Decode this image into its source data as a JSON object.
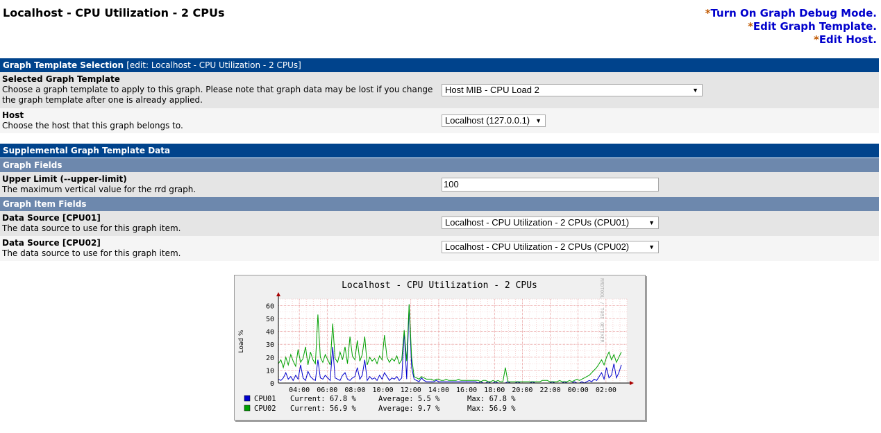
{
  "page": {
    "title": "Localhost - CPU Utilization - 2 CPUs"
  },
  "top_links": [
    {
      "star": "*",
      "label": "Turn On Graph Debug Mode."
    },
    {
      "star": "*",
      "label": "Edit Graph Template."
    },
    {
      "star": "*",
      "label": "Edit Host."
    }
  ],
  "template_section": {
    "header": "Graph Template Selection",
    "header_edit": "[edit: Localhost - CPU Utilization - 2 CPUs]",
    "selected_template": {
      "label": "Selected Graph Template",
      "desc": "Choose a graph template to apply to this graph. Please note that graph data may be lost if you change the graph template after one is already applied.",
      "value": "Host MIB - CPU Load 2"
    },
    "host": {
      "label": "Host",
      "desc": "Choose the host that this graph belongs to.",
      "value": "Localhost (127.0.0.1)"
    }
  },
  "supplemental": {
    "header": "Supplemental Graph Template Data",
    "graph_fields": "Graph Fields",
    "upper_limit": {
      "label": "Upper Limit (--upper-limit)",
      "desc": "The maximum vertical value for the rrd graph.",
      "value": "100"
    },
    "graph_item_fields": "Graph Item Fields",
    "ds1": {
      "label": "Data Source [CPU01]",
      "desc": "The data source to use for this graph item.",
      "value": "Localhost - CPU Utilization - 2 CPUs (CPU01)"
    },
    "ds2": {
      "label": "Data Source [CPU02]",
      "desc": "The data source to use for this graph item.",
      "value": "Localhost - CPU Utilization - 2 CPUs (CPU02)"
    }
  },
  "icons": {
    "dropdown": "triangle-down"
  },
  "chart_data": {
    "type": "line",
    "title": "Localhost - CPU Utilization - 2 CPUs",
    "ylabel": "Load %",
    "watermark": "RRDTOOL / TOBI OETIKER",
    "ylim": [
      0,
      65
    ],
    "yticks": [
      0,
      10,
      20,
      30,
      40,
      50,
      60
    ],
    "x_tick_labels": [
      "04:00",
      "06:00",
      "08:00",
      "10:00",
      "12:00",
      "14:00",
      "16:00",
      "18:00",
      "20:00",
      "22:00",
      "00:00",
      "02:00"
    ],
    "x_hours": [
      2.5,
      27.5
    ],
    "x_first_tick_hour": 4,
    "grid": true,
    "series": [
      {
        "name": "CPU01",
        "color": "#0000cc",
        "current": "67.8 %",
        "average": "5.5 %",
        "max": "67.8 %",
        "values": [
          3,
          2,
          4,
          8,
          3,
          5,
          2,
          6,
          3,
          14,
          4,
          2,
          9,
          5,
          3,
          2,
          18,
          4,
          3,
          6,
          4,
          2,
          28,
          4,
          3,
          2,
          6,
          8,
          3,
          2,
          4,
          5,
          12,
          3,
          6,
          18,
          2,
          5,
          3,
          4,
          2,
          6,
          3,
          8,
          5,
          2,
          4,
          3,
          5,
          2,
          4,
          40,
          3,
          60,
          12,
          3,
          2,
          1,
          4,
          2,
          1,
          1,
          1,
          1,
          2,
          1,
          1,
          1,
          1,
          1,
          1,
          1,
          1,
          1,
          1,
          1,
          1,
          1,
          1,
          1,
          1,
          0,
          1,
          0,
          0,
          1,
          0,
          0,
          1,
          0,
          0,
          0,
          0,
          1,
          0,
          0,
          0,
          1,
          0,
          0,
          0,
          0,
          0,
          1,
          0,
          0,
          0,
          0,
          0,
          0,
          0,
          1,
          0,
          0,
          0,
          0,
          1,
          0,
          0,
          0,
          1,
          0,
          0,
          1,
          0,
          1,
          2,
          1,
          3,
          2,
          5,
          8,
          3,
          12,
          4,
          6,
          15,
          4,
          8,
          14
        ]
      },
      {
        "name": "CPU02",
        "color": "#00a000",
        "current": "56.9 %",
        "average": "9.7 %",
        "max": "56.9 %",
        "values": [
          15,
          18,
          12,
          20,
          14,
          22,
          17,
          13,
          26,
          16,
          19,
          28,
          14,
          24,
          18,
          15,
          53,
          20,
          16,
          22,
          18,
          14,
          46,
          19,
          16,
          24,
          18,
          28,
          15,
          36,
          21,
          18,
          33,
          17,
          22,
          36,
          14,
          20,
          17,
          19,
          15,
          21,
          18,
          37,
          20,
          16,
          19,
          17,
          21,
          15,
          18,
          41,
          17,
          61,
          20,
          5,
          4,
          3,
          5,
          4,
          3,
          3,
          3,
          2,
          3,
          3,
          2,
          2,
          3,
          2,
          2,
          2,
          2,
          3,
          2,
          2,
          2,
          2,
          2,
          2,
          2,
          2,
          1,
          2,
          2,
          1,
          1,
          2,
          1,
          2,
          1,
          1,
          12,
          1,
          1,
          1,
          1,
          1,
          1,
          1,
          1,
          1,
          1,
          1,
          1,
          1,
          1,
          2,
          2,
          2,
          1,
          1,
          1,
          1,
          2,
          1,
          1,
          1,
          2,
          1,
          2,
          3,
          2,
          3,
          4,
          5,
          6,
          8,
          10,
          12,
          15,
          18,
          14,
          20,
          24,
          18,
          22,
          16,
          20,
          24
        ]
      }
    ]
  }
}
